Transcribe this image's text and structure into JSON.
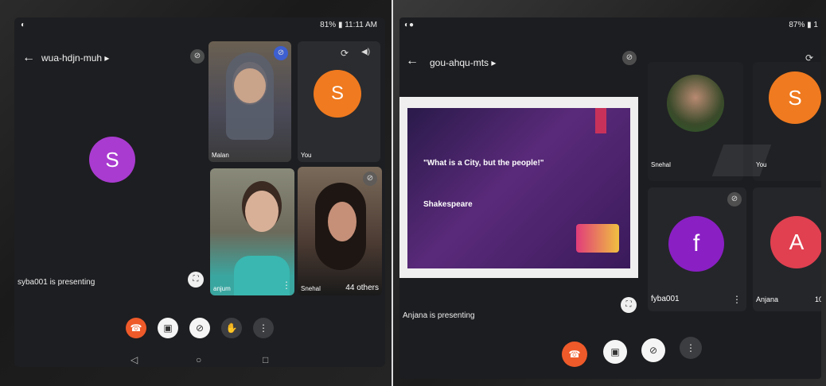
{
  "left": {
    "status_time": "81% ▮ 11:11 AM",
    "meeting_code": "wua-hdjn-muh",
    "presenter_avatar": "S",
    "presenting_text": "syba001 is presenting",
    "tiles": {
      "t1_name": "Malan",
      "t2_avatar": "S",
      "t2_name": "You",
      "t3_name": "anjum",
      "t4_name": "Snehal",
      "others": "44 others"
    },
    "colors": {
      "presenter_avatar": "#a93bd0",
      "you_avatar": "#f07a1f",
      "hangup": "#ee5a2a"
    }
  },
  "right": {
    "status_battery": "87% ▮ 1",
    "meeting_code": "gou-ahqu-mts",
    "slide": {
      "quote": "\"What is a City, but the people!\"",
      "author": "Shakespeare"
    },
    "presenting_text": "Anjana is presenting",
    "tiles": {
      "t1_name": "Snehal",
      "t2_avatar": "S",
      "t2_name": "You",
      "t3_avatar": "f",
      "t3_name": "fyba001",
      "t4_avatar": "A",
      "t4_name": "Anjana",
      "t4_extra": "10"
    },
    "colors": {
      "you_avatar": "#f07a1f",
      "f_avatar": "#8a1fc4",
      "a_avatar": "#e04050",
      "hangup": "#ee5a2a"
    }
  },
  "icons": {
    "back": "←",
    "dropdown": "▸",
    "mic_off": "⊘",
    "camera_flip": "⟳",
    "speaker": "◀)",
    "hangup": "☎",
    "cam_off": "▣",
    "hand": "✋",
    "more": "⋮",
    "expand": "⛶",
    "nav_back": "◁",
    "nav_home": "○",
    "nav_recent": "□"
  }
}
